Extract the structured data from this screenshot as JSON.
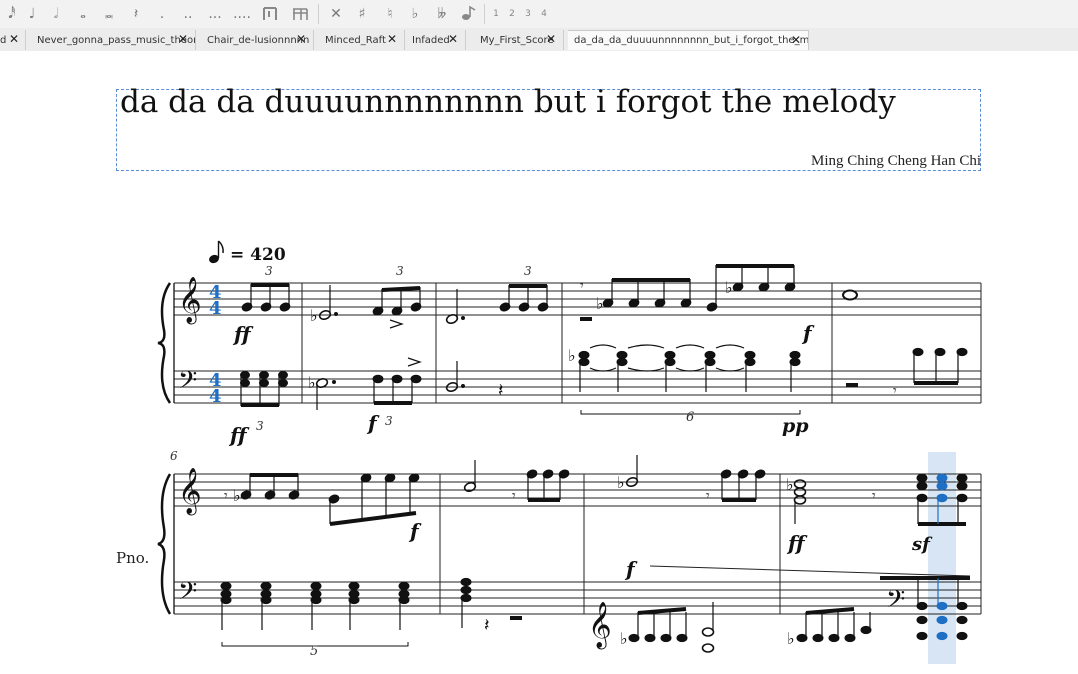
{
  "palette": {
    "note_values": [
      "𝅘𝅥𝅰",
      "♩",
      "𝅗𝅥",
      "𝅝",
      "𝅜",
      "𝄽",
      ".",
      "..",
      "...",
      "...."
    ],
    "accidentals": [
      "✕",
      "♯",
      "♮",
      "♭",
      "𝄫"
    ],
    "voices": [
      "1",
      "2",
      "3",
      "4"
    ]
  },
  "tabs": [
    {
      "label": "d",
      "active": false
    },
    {
      "label": "Never_gonna_pass_music_theory",
      "active": false
    },
    {
      "label": "Chair_de-lusionnnnn",
      "active": false
    },
    {
      "label": "Minced_Raft",
      "active": false
    },
    {
      "label": "Infaded",
      "active": false
    },
    {
      "label": "My_First_Score",
      "active": false
    },
    {
      "label": "da_da_da_duuuunnnnnnnn_but_i_forgot_the_melody*",
      "active": true
    }
  ],
  "close_glyph": "✕",
  "score": {
    "title": "da da da duuuunnnnnnnn but i forgot the melody",
    "composer": "Ming Ching Cheng Han Chi",
    "tempo_equals": "= 420",
    "time_signature": "4",
    "instrument_abbrev": "Pno.",
    "system2_measure_number": "6",
    "dynamics": {
      "ff": "ff",
      "f": "f",
      "pp": "pp",
      "sf": "sf"
    },
    "tuplets": {
      "three": "3",
      "five": "5",
      "six": "6"
    },
    "highlight_color": "#1f6fc4",
    "selection_frame_color": "#5b8ed6"
  }
}
